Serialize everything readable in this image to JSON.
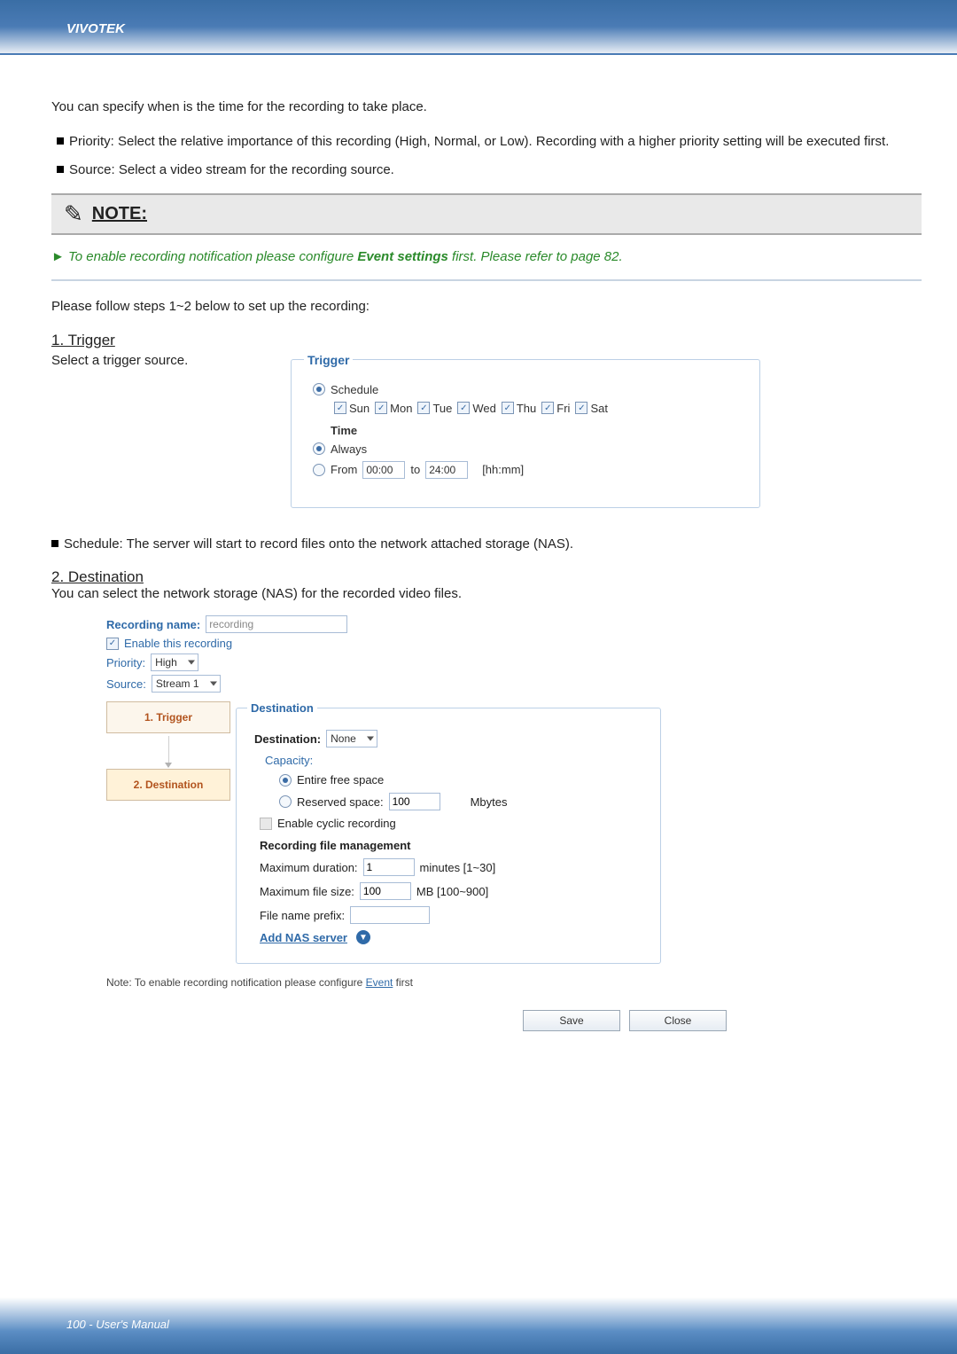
{
  "header": {
    "brand": "VIVOTEK"
  },
  "intro": "You can specify when is the time for the recording to take place.",
  "bullets": {
    "priority": "Priority: Select the relative importance of this recording (High, Normal, or Low). Recording with a higher priority setting will be executed first.",
    "source": "Source: Select a video stream for the recording source."
  },
  "note_label": "NOTE:",
  "note_text_prefix": "► To enable recording notification please configure ",
  "note_text_bold": "Event settings",
  "note_text_suffix": " first. Please refer to page 82.",
  "follow_steps": "Please follow steps 1~2 below to set up the recording:",
  "section1": {
    "title": "1. Trigger",
    "desc": "Select a trigger source."
  },
  "trigger": {
    "legend": "Trigger",
    "schedule_label": "Schedule",
    "days": {
      "sun": "Sun",
      "mon": "Mon",
      "tue": "Tue",
      "wed": "Wed",
      "thu": "Thu",
      "fri": "Fri",
      "sat": "Sat"
    },
    "time_label": "Time",
    "always": "Always",
    "from": "From",
    "from_val": "00:00",
    "to": "to",
    "to_val": "24:00",
    "hhmm": "[hh:mm]"
  },
  "schedule_desc": "Schedule: The server will start to record files onto the network attached storage (NAS).",
  "section2": {
    "title": "2. Destination",
    "desc": "You can select the network storage (NAS) for the recorded video files."
  },
  "rec": {
    "name_label": "Recording name:",
    "name_value": "recording",
    "enable": "Enable this recording",
    "priority_label": "Priority:",
    "priority_value": "High",
    "source_label": "Source:",
    "source_value": "Stream 1"
  },
  "steps": {
    "s1": "1.  Trigger",
    "s2": "2.  Destination"
  },
  "dest": {
    "legend": "Destination",
    "dest_label": "Destination:",
    "dest_value": "None",
    "capacity": "Capacity:",
    "entire": "Entire free space",
    "reserved": "Reserved space:",
    "reserved_val": "100",
    "mbytes": "Mbytes",
    "cyclic": "Enable cyclic recording",
    "rfm": "Recording file management",
    "maxdur": "Maximum duration:",
    "maxdur_val": "1",
    "maxdur_unit": "minutes [1~30]",
    "maxsize": "Maximum file size:",
    "maxsize_val": "100",
    "maxsize_unit": "MB [100~900]",
    "prefix": "File name prefix:",
    "addnas": "Add NAS server"
  },
  "footnote_prefix": "Note: To enable recording notification please configure ",
  "footnote_link": "Event",
  "footnote_suffix": " first",
  "buttons": {
    "save": "Save",
    "close": "Close"
  },
  "footer": "100 - User's Manual"
}
